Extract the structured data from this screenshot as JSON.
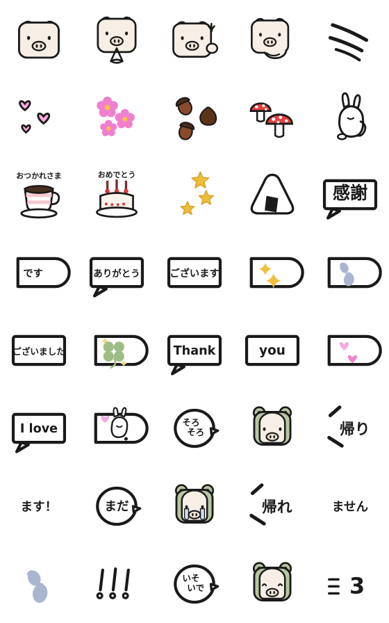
{
  "page": {
    "title": "Emoji sticker pack preview grid",
    "background_color": "#ffffff",
    "columns": 5,
    "rows": 8,
    "cell_size_px": 112,
    "ink_color": "#1a1a1a",
    "palette": {
      "ink": "#1a1a1a",
      "pig_body": "#f7efe6",
      "pig_shadow": "#efe3d6",
      "frog_green": "#b7c6a2",
      "frog_green_dark": "#9db085",
      "heart_pink": "#f7a8dd",
      "heart_pink_deep": "#f285cf",
      "flower_pink": "#f07fd0",
      "flower_center": "#f5c242",
      "acorn_brown": "#8a4b2a",
      "acorn_cap": "#4a2a18",
      "chestnut": "#5d3419",
      "mushroom_red": "#e8403f",
      "star_yellow": "#edbe3a",
      "sparkle_yellow": "#f0c03c",
      "clover_green": "#9dbd84",
      "footprint_blue": "#aab6d0",
      "cup_pink": "#f6c9cf",
      "bubble_white": "#ffffff",
      "tear_blue": "#cfe0ef",
      "cream": "#f8f4ec",
      "cherry_red": "#d93b3b",
      "nori_black": "#1a1a1a"
    }
  },
  "stickers": [
    {
      "row": 1,
      "col": 1,
      "name": "pig-face-plain",
      "kind": "character",
      "label": "Pig face",
      "text": ""
    },
    {
      "row": 1,
      "col": 2,
      "name": "pig-face-praying",
      "kind": "character",
      "label": "Pig praying",
      "text": ""
    },
    {
      "row": 1,
      "col": 3,
      "name": "pig-face-angry",
      "kind": "character",
      "label": "Pig with anger mark",
      "text": ""
    },
    {
      "row": 1,
      "col": 4,
      "name": "pig-face-lying",
      "kind": "character",
      "label": "Pig lying down",
      "text": ""
    },
    {
      "row": 1,
      "col": 5,
      "name": "speed-lines",
      "kind": "decoration",
      "label": "Speed lines",
      "text": ""
    },
    {
      "row": 2,
      "col": 1,
      "name": "hearts-outline",
      "kind": "decoration",
      "label": "Three outlined hearts",
      "text": ""
    },
    {
      "row": 2,
      "col": 2,
      "name": "sakura-flowers",
      "kind": "decoration",
      "label": "Three pink flowers",
      "text": ""
    },
    {
      "row": 2,
      "col": 3,
      "name": "acorns-chestnut",
      "kind": "decoration",
      "label": "Acorns and chestnut",
      "text": ""
    },
    {
      "row": 2,
      "col": 4,
      "name": "mushrooms",
      "kind": "decoration",
      "label": "Two red mushrooms",
      "text": ""
    },
    {
      "row": 2,
      "col": 5,
      "name": "rabbit",
      "kind": "character",
      "label": "Rabbit",
      "text": ""
    },
    {
      "row": 3,
      "col": 1,
      "name": "teacup-otsukaresama",
      "kind": "item",
      "label": "Teacup with text",
      "text": "おつかれさま"
    },
    {
      "row": 3,
      "col": 2,
      "name": "cake-omedetou",
      "kind": "item",
      "label": "Birthday cake with text",
      "text": "おめでとう"
    },
    {
      "row": 3,
      "col": 3,
      "name": "stars",
      "kind": "decoration",
      "label": "Three yellow stars",
      "text": ""
    },
    {
      "row": 3,
      "col": 4,
      "name": "onigiri",
      "kind": "item",
      "label": "Rice ball",
      "text": ""
    },
    {
      "row": 3,
      "col": 5,
      "name": "bubble-kansha",
      "kind": "bubble",
      "label": "Speech bubble",
      "text": "感謝"
    },
    {
      "row": 4,
      "col": 1,
      "name": "bubble-desu",
      "kind": "bubble",
      "label": "Speech bubble",
      "text": "です"
    },
    {
      "row": 4,
      "col": 2,
      "name": "bubble-arigatou",
      "kind": "bubble",
      "label": "Speech bubble",
      "text": "ありがとう"
    },
    {
      "row": 4,
      "col": 3,
      "name": "bubble-gozaimasu",
      "kind": "bubble",
      "label": "Speech bubble",
      "text": "ございます"
    },
    {
      "row": 4,
      "col": 4,
      "name": "bubble-sparkles",
      "kind": "bubble",
      "label": "Bubble with sparkles",
      "text": ""
    },
    {
      "row": 4,
      "col": 5,
      "name": "bubble-footprints",
      "kind": "bubble",
      "label": "Bubble with footprints",
      "text": ""
    },
    {
      "row": 5,
      "col": 1,
      "name": "bubble-gozaimashita",
      "kind": "bubble",
      "label": "Speech bubble",
      "text": "ございました"
    },
    {
      "row": 5,
      "col": 2,
      "name": "bubble-clover",
      "kind": "bubble",
      "label": "Bubble with four-leaf clover",
      "text": ""
    },
    {
      "row": 5,
      "col": 3,
      "name": "bubble-thank",
      "kind": "bubble",
      "label": "Speech bubble",
      "text": "Thank"
    },
    {
      "row": 5,
      "col": 4,
      "name": "bubble-you",
      "kind": "bubble",
      "label": "Speech bubble",
      "text": "you"
    },
    {
      "row": 5,
      "col": 5,
      "name": "bubble-hearts",
      "kind": "bubble",
      "label": "Bubble with pink hearts",
      "text": ""
    },
    {
      "row": 6,
      "col": 1,
      "name": "bubble-i-love",
      "kind": "bubble",
      "label": "Speech bubble",
      "text": "I love"
    },
    {
      "row": 6,
      "col": 2,
      "name": "bubble-rabbit-heart",
      "kind": "bubble",
      "label": "Bubble with rabbit and heart",
      "text": ""
    },
    {
      "row": 6,
      "col": 3,
      "name": "bubble-sorosoro",
      "kind": "bubble",
      "label": "Round speech bubble",
      "text": "そろそろ"
    },
    {
      "row": 6,
      "col": 4,
      "name": "frog-pig-normal",
      "kind": "character",
      "label": "Pig in frog hood",
      "text": ""
    },
    {
      "row": 6,
      "col": 5,
      "name": "text-kaeri",
      "kind": "text",
      "label": "Text with speed lines",
      "text": "帰り"
    },
    {
      "row": 7,
      "col": 1,
      "name": "text-masu",
      "kind": "text",
      "label": "Plain text",
      "text": "ます！"
    },
    {
      "row": 7,
      "col": 2,
      "name": "bubble-mada",
      "kind": "bubble",
      "label": "Round speech bubble",
      "text": "まだ"
    },
    {
      "row": 7,
      "col": 3,
      "name": "frog-pig-crying",
      "kind": "character",
      "label": "Crying pig in frog hood",
      "text": ""
    },
    {
      "row": 7,
      "col": 4,
      "name": "text-kaere",
      "kind": "text",
      "label": "Text with speed lines",
      "text": "帰れ"
    },
    {
      "row": 7,
      "col": 5,
      "name": "text-masen",
      "kind": "text",
      "label": "Plain text",
      "text": "ません"
    },
    {
      "row": 8,
      "col": 1,
      "name": "footprints",
      "kind": "decoration",
      "label": "Two footprints",
      "text": ""
    },
    {
      "row": 8,
      "col": 2,
      "name": "exclamation-marks",
      "kind": "decoration",
      "label": "Three exclamation marks",
      "text": "!!!"
    },
    {
      "row": 8,
      "col": 3,
      "name": "bubble-isoide",
      "kind": "bubble",
      "label": "Round speech bubble",
      "text": "いそいで"
    },
    {
      "row": 8,
      "col": 4,
      "name": "frog-pig-smiling",
      "kind": "character",
      "label": "Smiling pig in frog hood",
      "text": ""
    },
    {
      "row": 8,
      "col": 5,
      "name": "text-dash-three",
      "kind": "text",
      "label": "Dash lines with three",
      "text": "ミ3"
    }
  ]
}
